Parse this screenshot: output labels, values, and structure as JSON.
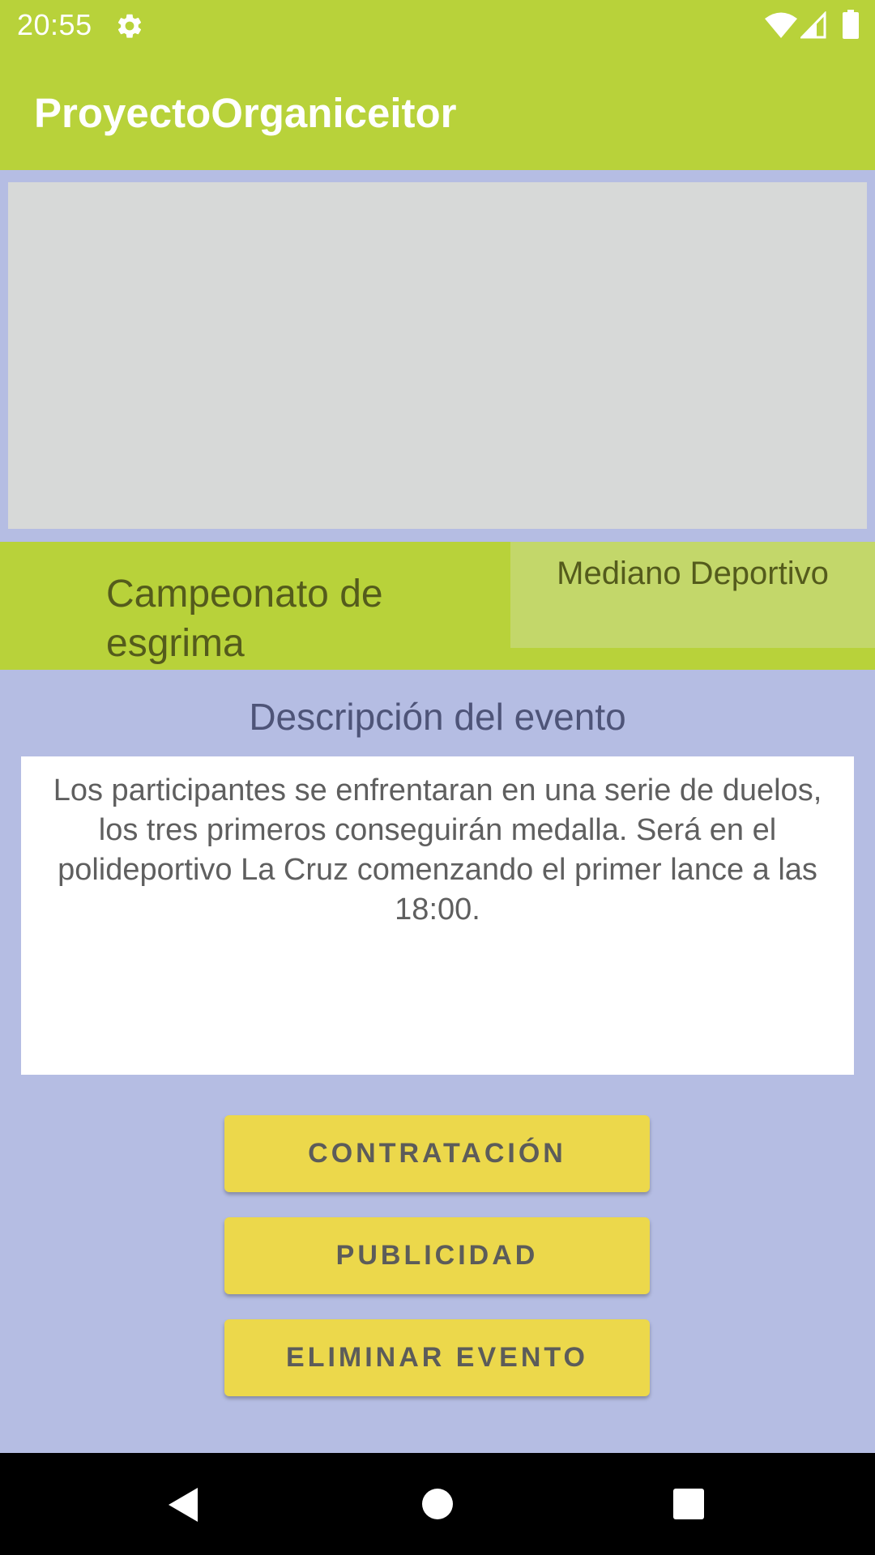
{
  "status_bar": {
    "time": "20:55",
    "icons": [
      "gear-icon",
      "wifi-icon",
      "signal-icon",
      "battery-icon"
    ]
  },
  "app_bar": {
    "title": "ProyectoOrganiceitor"
  },
  "event": {
    "name": "Campeonato de esgrima",
    "category": "Mediano Deportivo",
    "description_heading": "Descripción del evento",
    "description": "Los participantes se enfrentaran en una serie de duelos, los tres primeros conseguirán medalla. Será en el polideportivo La Cruz comenzando el primer lance a las 18:00."
  },
  "buttons": {
    "hiring": "CONTRATACIÓN",
    "advertising": "PUBLICIDAD",
    "delete_event": "ELIMINAR EVENTO"
  },
  "nav_bar": {
    "icons": [
      "back-icon",
      "home-icon",
      "recents-icon"
    ]
  },
  "colors": {
    "primary": "#b8d23a",
    "background": "#b5bde3",
    "button": "#ecd84b",
    "image_placeholder": "#d7d9d8",
    "category_box": "#c3d76a"
  }
}
